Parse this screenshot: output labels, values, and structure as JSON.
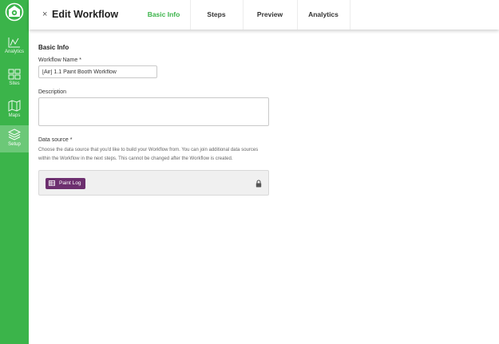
{
  "header": {
    "close_glyph": "×",
    "title": "Edit Workflow",
    "tabs": [
      {
        "label": "Basic Info",
        "active": true
      },
      {
        "label": "Steps",
        "active": false
      },
      {
        "label": "Preview",
        "active": false
      },
      {
        "label": "Analytics",
        "active": false
      }
    ]
  },
  "sidebar": {
    "items": [
      {
        "label": "Analytics",
        "icon": "chart-icon"
      },
      {
        "label": "Sites",
        "icon": "sites-icon"
      },
      {
        "label": "Maps",
        "icon": "map-icon"
      },
      {
        "label": "Setup",
        "icon": "layers-icon",
        "active": true
      }
    ]
  },
  "form": {
    "section_title": "Basic Info",
    "workflow_name_label": "Workflow Name",
    "required_mark": "*",
    "workflow_name_value": "[Air] 1.1 Paint Booth Workflow",
    "description_label": "Description",
    "description_value": "",
    "data_source_label": "Data source",
    "data_source_help": "Choose the data source that you'd like to build your Workflow from. You can join additional data sources within the Workflow in the next steps. This cannot be changed after the Workflow is created.",
    "data_source_chip": "Paint Log"
  },
  "colors": {
    "brand_green": "#3bb44a",
    "chip_purple": "#6d2f6f"
  }
}
